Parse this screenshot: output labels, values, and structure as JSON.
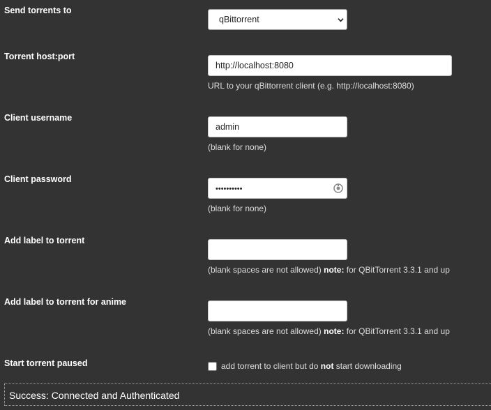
{
  "send_to": {
    "label": "Send torrents to",
    "selected": "qBittorrent"
  },
  "host": {
    "label": "Torrent host:port",
    "value": "http://localhost:8080",
    "help": "URL to your qBittorrent client (e.g. http://localhost:8080)"
  },
  "username": {
    "label": "Client username",
    "value": "admin",
    "help": "(blank for none)"
  },
  "password": {
    "label": "Client password",
    "masked_value": "••••••••••",
    "help": "(blank for none)",
    "reveal_icon": "eye-icon"
  },
  "torrent_label": {
    "label": "Add label to torrent",
    "value": "",
    "help_prefix": "(blank spaces are not allowed)",
    "help_note": "note:",
    "help_suffix": "for QBitTorrent 3.3.1 and up"
  },
  "anime_label": {
    "label": "Add label to torrent for anime",
    "value": "",
    "help_prefix": "(blank spaces are not allowed)",
    "help_note": "note:",
    "help_suffix": "for QBitTorrent 3.3.1 and up"
  },
  "paused": {
    "label": "Start torrent paused",
    "checked": false,
    "text_prefix": "add torrent to client but do",
    "text_bold": "not",
    "text_suffix": "start downloading"
  },
  "status": {
    "text": "Success: Connected and Authenticated"
  }
}
